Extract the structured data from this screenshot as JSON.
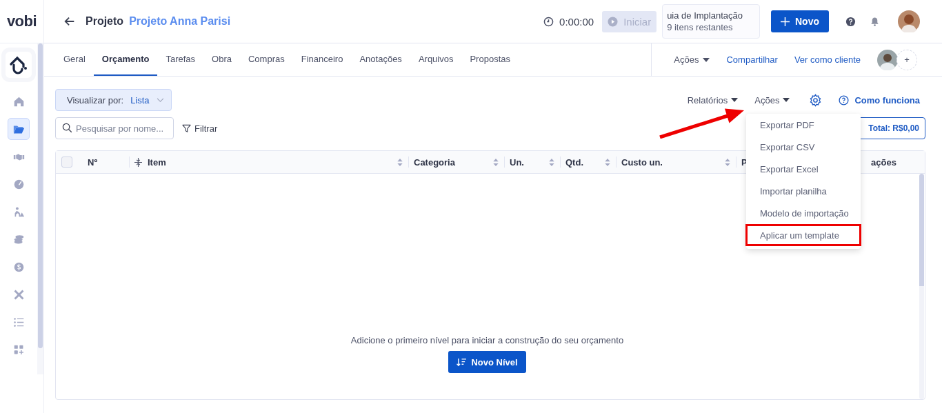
{
  "sidebar": {
    "logo": "vobi",
    "items": [
      {
        "selected": false
      },
      {
        "selected": true
      },
      {
        "selected": false
      },
      {
        "selected": false
      },
      {
        "selected": false
      },
      {
        "selected": false
      },
      {
        "selected": false
      },
      {
        "selected": false
      },
      {
        "selected": false
      },
      {
        "selected": false
      }
    ]
  },
  "header": {
    "title": "Projeto",
    "project": "Projeto Anna Parisi",
    "timer": "0:00:00",
    "start_button": {
      "label": "Iniciar",
      "disabled": true
    },
    "guide": {
      "title": "uia de Implantação",
      "subtitle": "9 itens restantes"
    },
    "new_button": "Novo"
  },
  "tabs": [
    {
      "label": "Geral",
      "selected": false
    },
    {
      "label": "Orçamento",
      "selected": true
    },
    {
      "label": "Tarefas",
      "selected": false
    },
    {
      "label": "Obra",
      "selected": false
    },
    {
      "label": "Compras",
      "selected": false
    },
    {
      "label": "Financeiro",
      "selected": false
    },
    {
      "label": "Anotações",
      "selected": false
    },
    {
      "label": "Arquivos",
      "selected": false
    },
    {
      "label": "Propostas",
      "selected": false
    }
  ],
  "tab_actions": {
    "actions": "Ações",
    "share": "Compartilhar",
    "client_view": "Ver como cliente",
    "add_member": "+"
  },
  "toolbar": {
    "view_label": "Visualizar por:",
    "view_value": "Lista",
    "reports": "Relatórios",
    "actions": "Ações",
    "help": "Como funciona",
    "search": {
      "placeholder": "Pesquisar por nome..."
    },
    "filter": "Filtrar",
    "total": "Total: R$0,00"
  },
  "table": {
    "select_all": {
      "checked": false
    },
    "columns": [
      {
        "label": "Nº",
        "sortable": false
      },
      {
        "label": "Item",
        "sortable": true
      },
      {
        "label": "Categoria",
        "sortable": true
      },
      {
        "label": "Un.",
        "sortable": true
      },
      {
        "label": "Qtd.",
        "sortable": true
      },
      {
        "label": "Custo un.",
        "sortable": true
      },
      {
        "label": "P",
        "sortable": false
      },
      {
        "label": "ações",
        "sortable": false
      }
    ],
    "empty_message": "Adicione o primeiro nível para iniciar a construção do seu orçamento",
    "add_level_button": "Novo Nível"
  },
  "actions_menu": {
    "items": [
      {
        "label": "Exportar PDF",
        "highlighted": false
      },
      {
        "label": "Exportar CSV",
        "highlighted": false
      },
      {
        "label": "Exportar Excel",
        "highlighted": false
      },
      {
        "label": "Importar planilha",
        "highlighted": false
      },
      {
        "label": "Modelo de importação",
        "highlighted": false
      },
      {
        "label": "Aplicar um template",
        "highlighted": true
      }
    ]
  }
}
